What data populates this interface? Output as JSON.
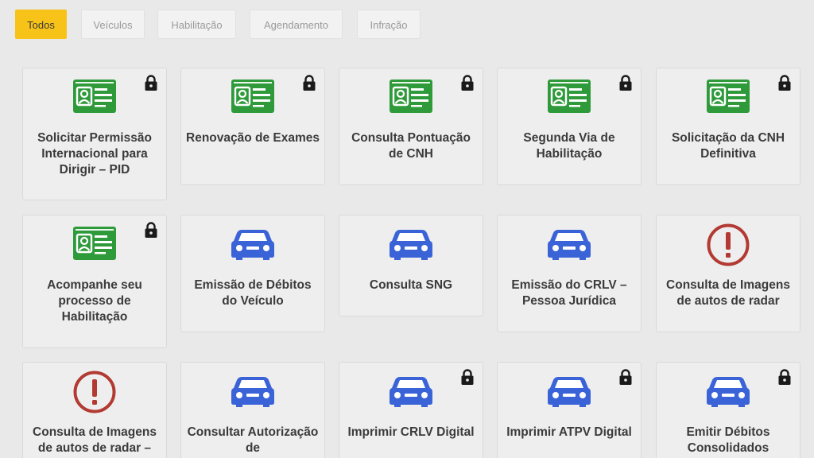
{
  "filters": [
    {
      "label": "Todos",
      "active": true
    },
    {
      "label": "Veículos",
      "active": false
    },
    {
      "label": "Habilitação",
      "active": false
    },
    {
      "label": "Agendamento",
      "active": false
    },
    {
      "label": "Infração",
      "active": false
    }
  ],
  "colors": {
    "accent": "#f7c318",
    "license_green": "#2e9a3a",
    "car_blue": "#3a63d8",
    "alert_red": "#b23a32",
    "lock": "#1a1a1a"
  },
  "cards": [
    {
      "label": "Solicitar Permissão Internacional para Dirigir – PID",
      "icon": "license-card-icon",
      "locked": true
    },
    {
      "label": "Renovação de Exames",
      "icon": "license-card-icon",
      "locked": true
    },
    {
      "label": "Consulta Pontuação de CNH",
      "icon": "license-card-icon",
      "locked": true
    },
    {
      "label": "Segunda Via de Habilitação",
      "icon": "license-card-icon",
      "locked": true
    },
    {
      "label": "Solicitação da CNH Definitiva",
      "icon": "license-card-icon",
      "locked": true
    },
    {
      "label": "Acompanhe seu processo de Habilitação",
      "icon": "license-card-icon",
      "locked": true
    },
    {
      "label": "Emissão de Débitos do Veículo",
      "icon": "car-icon",
      "locked": false
    },
    {
      "label": "Consulta SNG",
      "icon": "car-icon",
      "locked": false
    },
    {
      "label": "Emissão do CRLV – Pessoa Jurídica",
      "icon": "car-icon",
      "locked": false
    },
    {
      "label": "Consulta de Imagens de autos de radar",
      "icon": "alert-icon",
      "locked": false
    },
    {
      "label": "Consulta de Imagens de autos de radar –",
      "icon": "alert-icon",
      "locked": false
    },
    {
      "label": "Consultar Autorização de",
      "icon": "car-icon",
      "locked": false
    },
    {
      "label": "Imprimir CRLV Digital",
      "icon": "car-icon",
      "locked": true
    },
    {
      "label": "Imprimir ATPV Digital",
      "icon": "car-icon",
      "locked": true
    },
    {
      "label": "Emitir Débitos Consolidados",
      "icon": "car-icon",
      "locked": true
    }
  ]
}
